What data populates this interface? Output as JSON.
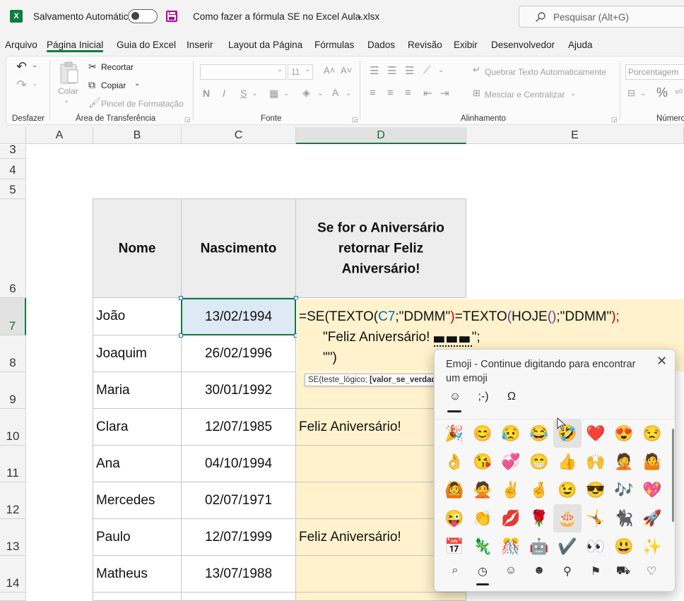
{
  "titlebar": {
    "app_icon": "X",
    "autosave_label": "Salvamento Automático",
    "autosave_state": "off",
    "document_title": "Como fazer a fórmula SE no Excel Aula.xlsx",
    "search_placeholder": "Pesquisar (Alt+G)"
  },
  "tabs": [
    "Arquivo",
    "Página Inicial",
    "Guia do Excel",
    "Inserir",
    "Layout da Página",
    "Fórmulas",
    "Dados",
    "Revisão",
    "Exibir",
    "Desenvolvedor",
    "Ajuda"
  ],
  "active_tab": "Página Inicial",
  "ribbon": {
    "undo": {
      "label": "Desfazer"
    },
    "clipboard": {
      "label": "Área de Transferência",
      "paste": "Colar",
      "cut": "Recortar",
      "copy": "Copiar",
      "format_painter": "Pincel de Formatação"
    },
    "font": {
      "label": "Fonte",
      "font_name": "",
      "font_size": "11",
      "bold": "N",
      "italic": "I",
      "underline": "S"
    },
    "alignment": {
      "label": "Alinhamento",
      "wrap_text": "Quebrar Texto Automaticamente",
      "merge_center": "Mesclar e Centralizar"
    },
    "number": {
      "label": "Número",
      "format": "Porcentagem",
      "percent": "%"
    }
  },
  "sheet": {
    "columns": [
      "A",
      "B",
      "C",
      "D",
      "E"
    ],
    "selected_column": "D",
    "rows": [
      "3",
      "4",
      "5",
      "6",
      "7",
      "8",
      "9",
      "10",
      "11",
      "12",
      "13",
      "14"
    ],
    "selected_row": "7",
    "headers": {
      "name": "Nome",
      "birth": "Nascimento",
      "result": "Se for o Aniversário retornar Feliz Aniversário!"
    },
    "data": [
      {
        "name": "João",
        "birth": "13/02/1994",
        "result": ""
      },
      {
        "name": "Joaquim",
        "birth": "26/02/1996",
        "result": ""
      },
      {
        "name": "Maria",
        "birth": "30/01/1992",
        "result": ""
      },
      {
        "name": "Clara",
        "birth": "12/07/1985",
        "result": "Feliz Aniversário!"
      },
      {
        "name": "Ana",
        "birth": "04/10/1994",
        "result": ""
      },
      {
        "name": "Mercedes",
        "birth": "02/07/1971",
        "result": ""
      },
      {
        "name": "Paulo",
        "birth": "12/07/1999",
        "result": "Feliz Aniversário!"
      },
      {
        "name": "Matheus",
        "birth": "13/07/1988",
        "result": ""
      }
    ],
    "formula": {
      "p1": "=SE(TEXTO(",
      "ref": "C7",
      "p2": ";\"DDMM\"",
      "p3": ")",
      "p4": "=TEXTO",
      "p5": "(",
      "p6": "HOJE",
      "p7": "()",
      "p8": ";\"DDMM\"",
      "p9": ");",
      "line2_a": "\"Feliz Aniversário! ",
      "line2_b": "\";",
      "line3": "\"\")"
    },
    "tooltip": {
      "plain": "SE(teste_lógico; ",
      "bold": "[valor_se_verdadeiro]"
    }
  },
  "emoji_panel": {
    "title": "Emoji - Continue digitando para encontrar um emoji",
    "tabs": [
      "☺",
      ";-)",
      "Ω"
    ],
    "emojis": [
      "🎉",
      "😊",
      "😥",
      "😂",
      "🤣",
      "❤️",
      "😍",
      "😒",
      "👌",
      "😘",
      "💞",
      "😁",
      "👍",
      "🙌",
      "🤦",
      "🤷",
      "🙆",
      "🙅",
      "✌️",
      "🤞",
      "😉",
      "😎",
      "🎶",
      "💖",
      "😜",
      "👏",
      "💋",
      "🌹",
      "🎂",
      "🤸",
      "🐈‍⬛",
      "🚀",
      "📅",
      "🦎",
      "🎊",
      "🤖",
      "✔️",
      "👀",
      "😃",
      "✨"
    ],
    "highlighted": [
      "🤣",
      "🎂"
    ],
    "bottom_icons": [
      "search-icon",
      "recent-clock-icon",
      "smiley-icon",
      "people-icon",
      "place-icon",
      "celebration-icon",
      "car-icon",
      "heart-icon"
    ]
  }
}
